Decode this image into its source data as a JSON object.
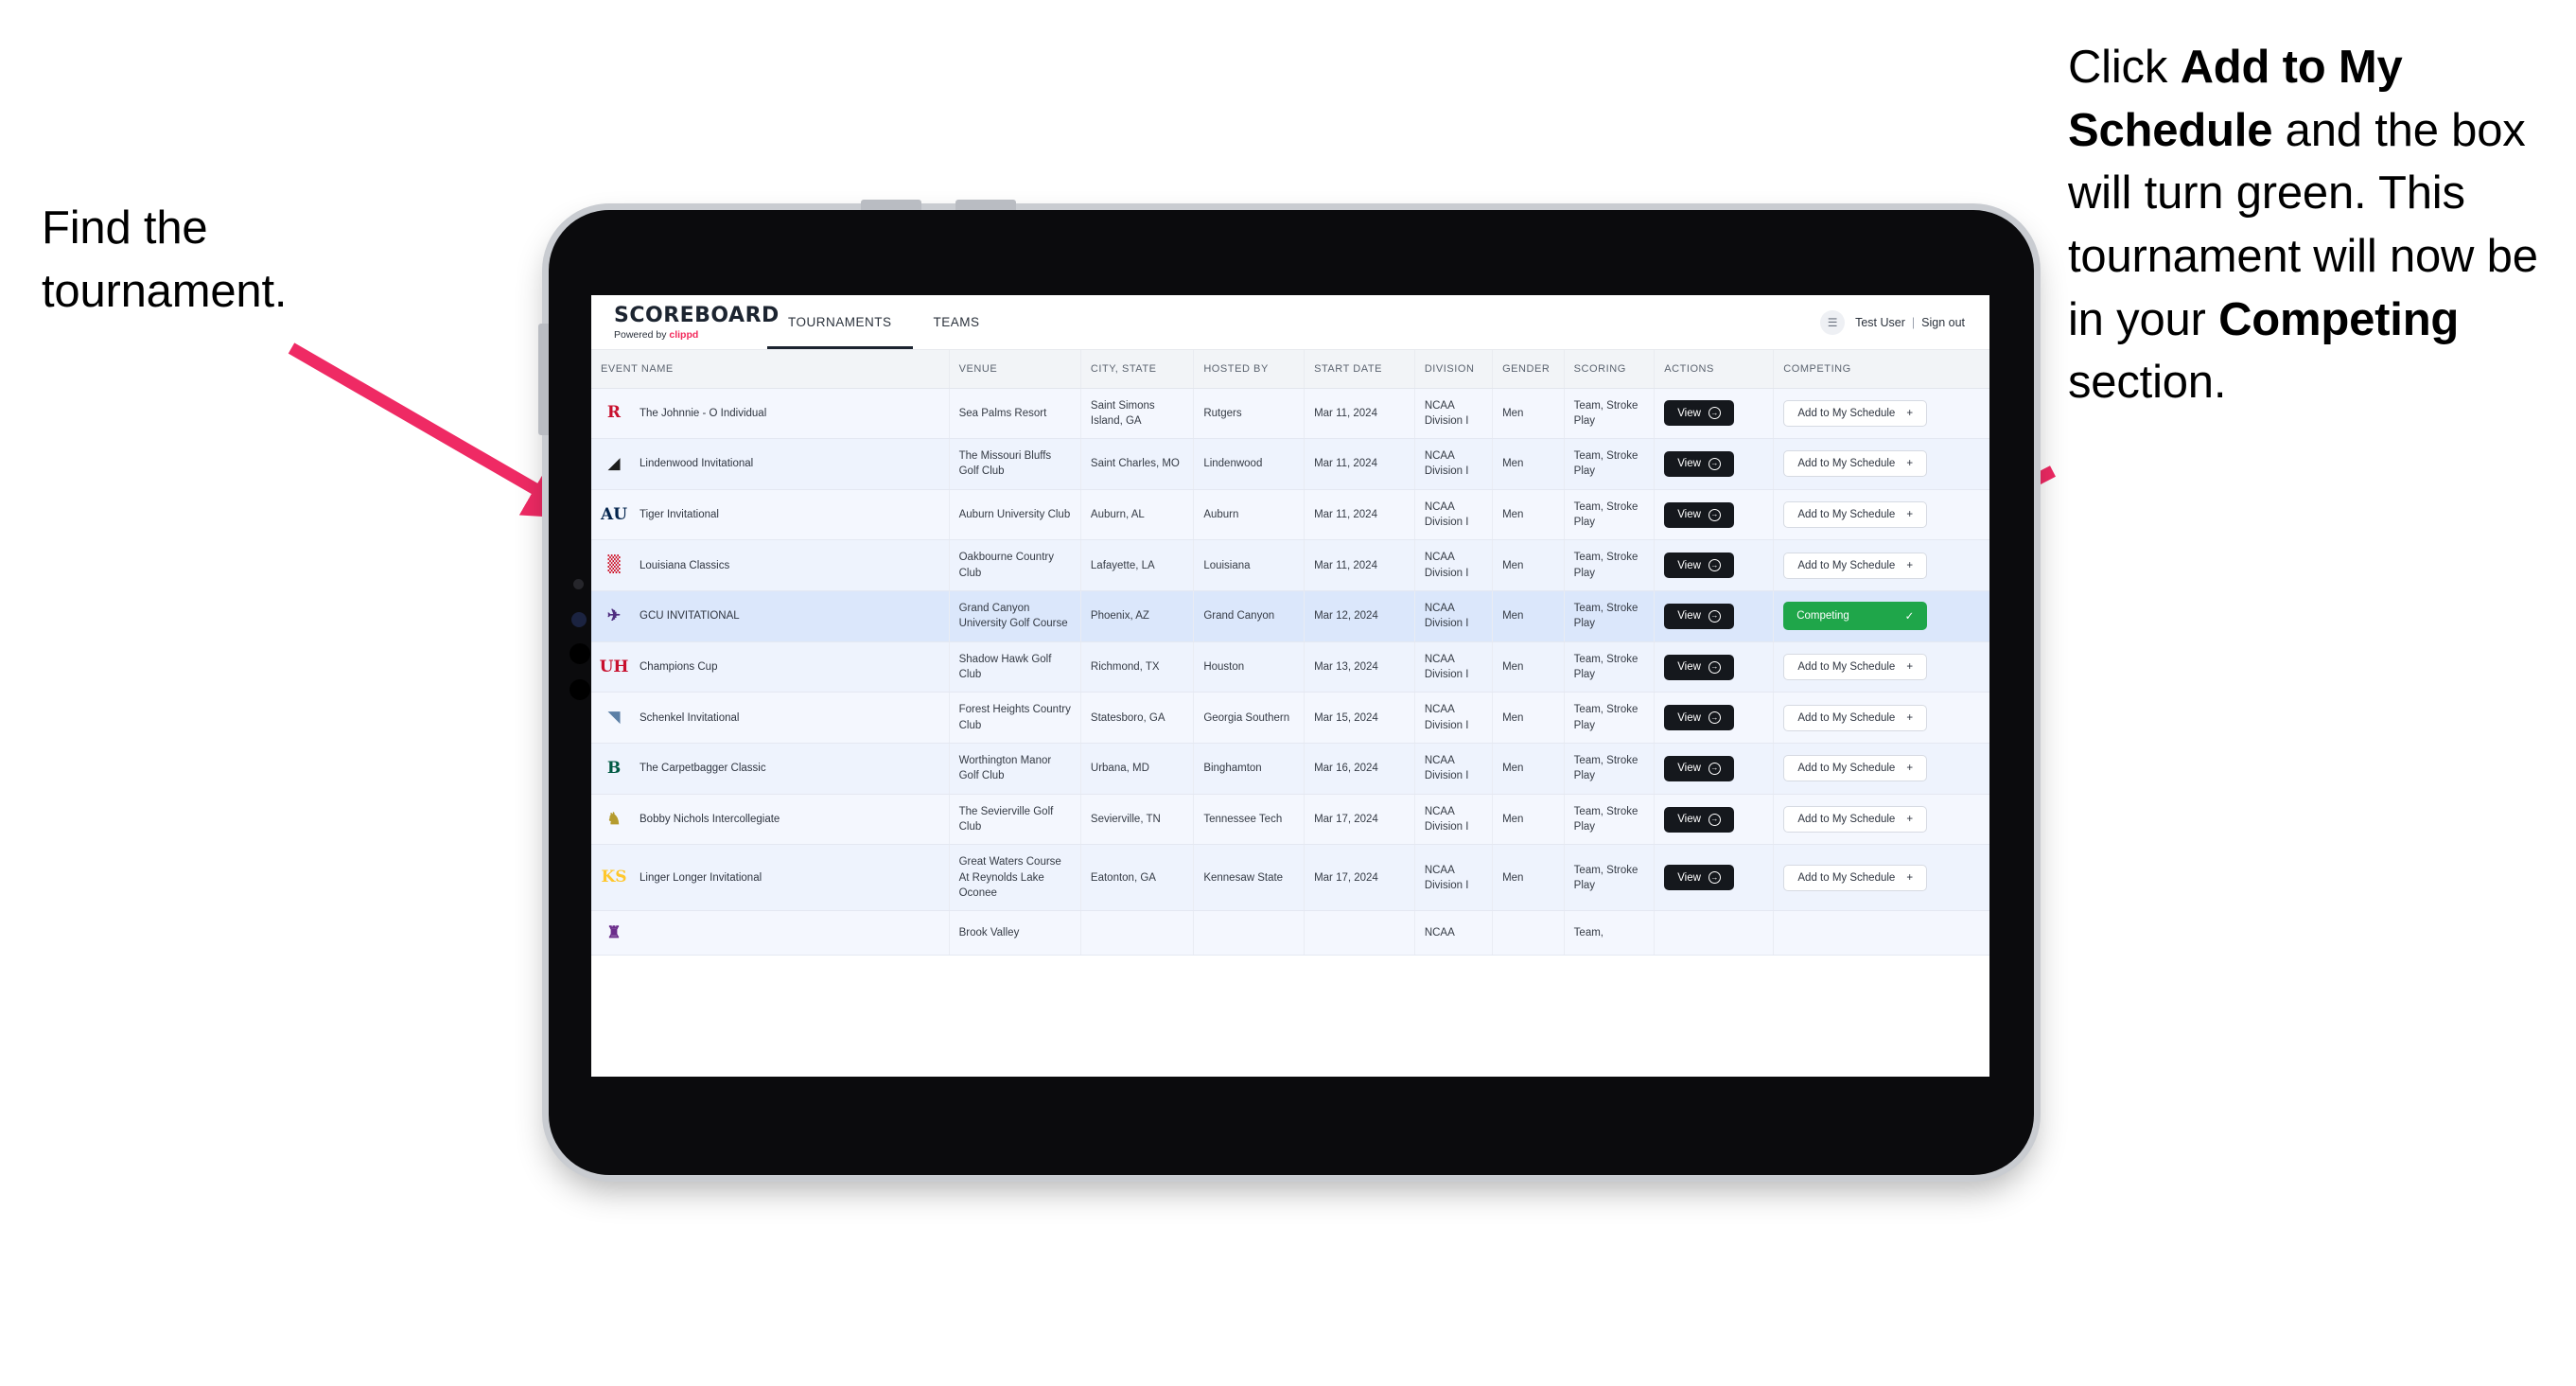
{
  "annotations": {
    "left": "Find the tournament.",
    "right_parts": [
      {
        "t": "Click ",
        "b": false
      },
      {
        "t": "Add to My Schedule",
        "b": true
      },
      {
        "t": " and the box will turn green. This tournament will now be in your ",
        "b": false
      },
      {
        "t": "Competing",
        "b": true
      },
      {
        "t": " section.",
        "b": false
      }
    ]
  },
  "app": {
    "brand": {
      "title": "SCOREBOARD",
      "powered_prefix": "Powered by ",
      "powered_brand": "clippd"
    },
    "tabs": [
      {
        "label": "TOURNAMENTS",
        "active": true
      },
      {
        "label": "TEAMS",
        "active": false
      }
    ],
    "user": {
      "name": "Test User",
      "separator": "|",
      "signout": "Sign out",
      "avatar_glyph": "☰"
    }
  },
  "table": {
    "columns": [
      "EVENT NAME",
      "VENUE",
      "CITY, STATE",
      "HOSTED BY",
      "START DATE",
      "DIVISION",
      "GENDER",
      "SCORING",
      "ACTIONS",
      "COMPETING"
    ],
    "view_label": "View",
    "view_icon": "→",
    "add_label": "Add to My Schedule",
    "add_icon": "+",
    "competing_label": "Competing",
    "competing_icon": "✓",
    "rows": [
      {
        "logo": "R",
        "logo_color": "#c8102e",
        "event": "The Johnnie - O Individual",
        "venue": "Sea Palms Resort",
        "city": "Saint Simons Island, GA",
        "host": "Rutgers",
        "date": "Mar 11, 2024",
        "division": "NCAA Division I",
        "gender": "Men",
        "scoring": "Team, Stroke Play",
        "competing": false
      },
      {
        "logo": "◢",
        "logo_color": "#1c1c1c",
        "event": "Lindenwood Invitational",
        "venue": "The Missouri Bluffs Golf Club",
        "city": "Saint Charles, MO",
        "host": "Lindenwood",
        "date": "Mar 11, 2024",
        "division": "NCAA Division I",
        "gender": "Men",
        "scoring": "Team, Stroke Play",
        "competing": false
      },
      {
        "logo": "AU",
        "logo_color": "#03244d",
        "event": "Tiger Invitational",
        "venue": "Auburn University Club",
        "city": "Auburn, AL",
        "host": "Auburn",
        "date": "Mar 11, 2024",
        "division": "NCAA Division I",
        "gender": "Men",
        "scoring": "Team, Stroke Play",
        "competing": false
      },
      {
        "logo": "▒",
        "logo_color": "#ce1126",
        "event": "Louisiana Classics",
        "venue": "Oakbourne Country Club",
        "city": "Lafayette, LA",
        "host": "Louisiana",
        "date": "Mar 11, 2024",
        "division": "NCAA Division I",
        "gender": "Men",
        "scoring": "Team, Stroke Play",
        "competing": false
      },
      {
        "logo": "✈",
        "logo_color": "#4f2d7f",
        "event": "GCU INVITATIONAL",
        "venue": "Grand Canyon University Golf Course",
        "city": "Phoenix, AZ",
        "host": "Grand Canyon",
        "date": "Mar 12, 2024",
        "division": "NCAA Division I",
        "gender": "Men",
        "scoring": "Team, Stroke Play",
        "competing": true,
        "selected": true
      },
      {
        "logo": "UH",
        "logo_color": "#c8102e",
        "event": "Champions Cup",
        "venue": "Shadow Hawk Golf Club",
        "city": "Richmond, TX",
        "host": "Houston",
        "date": "Mar 13, 2024",
        "division": "NCAA Division I",
        "gender": "Men",
        "scoring": "Team, Stroke Play",
        "competing": false
      },
      {
        "logo": "◥",
        "logo_color": "#5b7fa6",
        "event": "Schenkel Invitational",
        "venue": "Forest Heights Country Club",
        "city": "Statesboro, GA",
        "host": "Georgia Southern",
        "date": "Mar 15, 2024",
        "division": "NCAA Division I",
        "gender": "Men",
        "scoring": "Team, Stroke Play",
        "competing": false
      },
      {
        "logo": "B",
        "logo_color": "#005a43",
        "event": "The Carpetbagger Classic",
        "venue": "Worthington Manor Golf Club",
        "city": "Urbana, MD",
        "host": "Binghamton",
        "date": "Mar 16, 2024",
        "division": "NCAA Division I",
        "gender": "Men",
        "scoring": "Team, Stroke Play",
        "competing": false
      },
      {
        "logo": "♞",
        "logo_color": "#b59b2e",
        "event": "Bobby Nichols Intercollegiate",
        "venue": "The Sevierville Golf Club",
        "city": "Sevierville, TN",
        "host": "Tennessee Tech",
        "date": "Mar 17, 2024",
        "division": "NCAA Division I",
        "gender": "Men",
        "scoring": "Team, Stroke Play",
        "competing": false
      },
      {
        "logo": "KS",
        "logo_color": "#ffc72c",
        "event": "Linger Longer Invitational",
        "venue": "Great Waters Course At Reynolds Lake Oconee",
        "city": "Eatonton, GA",
        "host": "Kennesaw State",
        "date": "Mar 17, 2024",
        "division": "NCAA Division I",
        "gender": "Men",
        "scoring": "Team, Stroke Play",
        "competing": false
      },
      {
        "logo": "♜",
        "logo_color": "#6b2d8b",
        "event": "",
        "venue": "Brook Valley",
        "city": "",
        "host": "",
        "date": "",
        "division": "NCAA",
        "gender": "",
        "scoring": "Team,",
        "competing": false,
        "clipped": true
      }
    ]
  },
  "colors": {
    "accent_pink": "#ef2a64",
    "competing_green": "#1fa64a",
    "dark": "#15181d",
    "row_selected": "#dbe7fb"
  }
}
